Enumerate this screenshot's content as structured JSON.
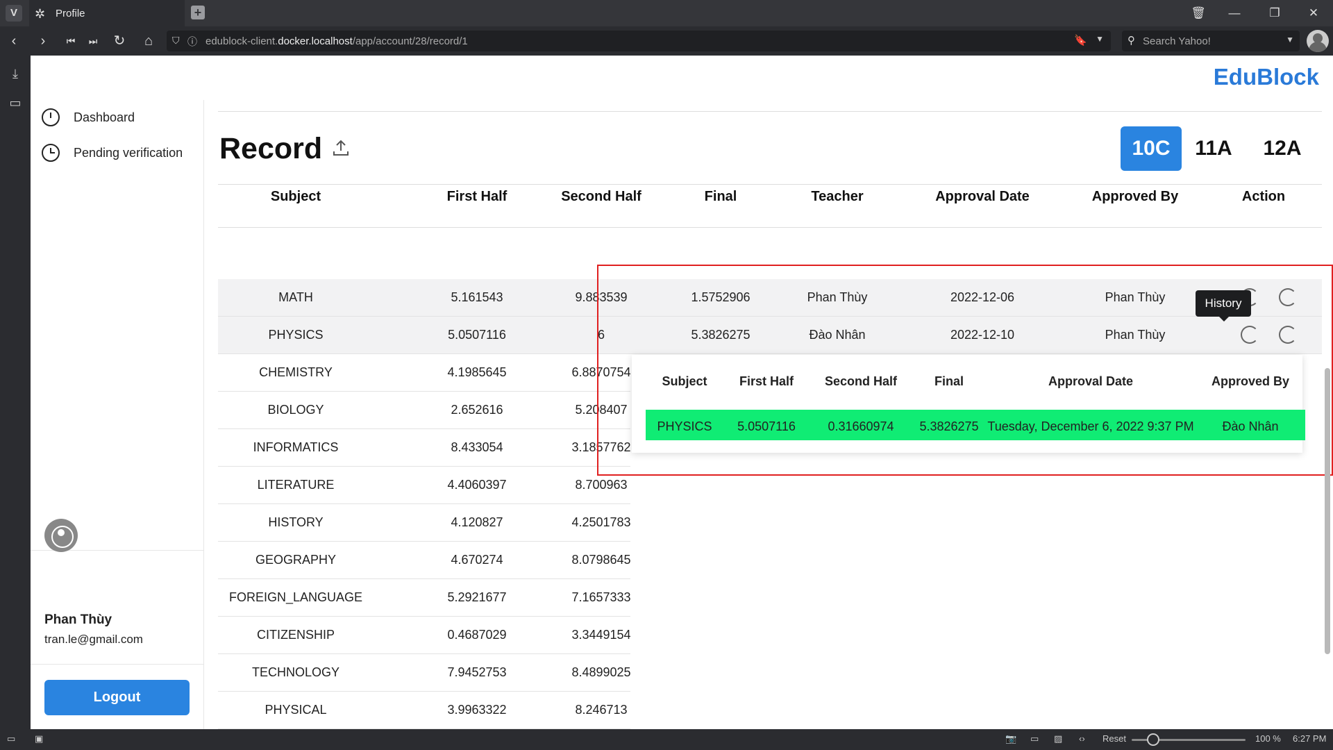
{
  "browser": {
    "tab_title": "Profile",
    "url_prefix": "edublock-client.",
    "url_host": "docker.localhost",
    "url_path": "/app/account/28/record/1",
    "search_placeholder": "Search Yahoo!",
    "status": {
      "reset": "Reset",
      "zoom": "100 %",
      "time": "6:27 PM"
    }
  },
  "app": {
    "brand": "EduBlock",
    "nav": [
      {
        "label": "Dashboard",
        "icon": "dashboard-icon"
      },
      {
        "label": "Pending verification",
        "icon": "clock-icon"
      }
    ],
    "user": {
      "name": "Phan Thùy",
      "email": "tran.le@gmail.com"
    },
    "logout_label": "Logout"
  },
  "page": {
    "title": "Record",
    "grades": [
      {
        "label": "10C",
        "active": true
      },
      {
        "label": "11A",
        "active": false
      },
      {
        "label": "12A",
        "active": false
      }
    ]
  },
  "table": {
    "headers": [
      "Subject",
      "First Half",
      "Second Half",
      "Final",
      "Teacher",
      "Approval Date",
      "Approved By",
      "Action"
    ],
    "rows": [
      {
        "subject": "MATH",
        "first": "5.161543",
        "second": "9.883539",
        "final": "1.5752906",
        "teacher": "Phan Thùy",
        "date": "2022-12-06",
        "approved_by": "Phan Thùy"
      },
      {
        "subject": "PHYSICS",
        "first": "5.0507116",
        "second": "6",
        "final": "5.3826275",
        "teacher": "Đào Nhân",
        "date": "2022-12-10",
        "approved_by": "Phan Thùy"
      },
      {
        "subject": "CHEMISTRY",
        "first": "4.1985645",
        "second": "6.8870754"
      },
      {
        "subject": "BIOLOGY",
        "first": "2.652616",
        "second": "5.208407"
      },
      {
        "subject": "INFORMATICS",
        "first": "8.433054",
        "second": "3.1857762"
      },
      {
        "subject": "LITERATURE",
        "first": "4.4060397",
        "second": "8.700963"
      },
      {
        "subject": "HISTORY",
        "first": "4.120827",
        "second": "4.2501783"
      },
      {
        "subject": "GEOGRAPHY",
        "first": "4.670274",
        "second": "8.0798645"
      },
      {
        "subject": "FOREIGN_LANGUAGE",
        "first": "5.2921677",
        "second": "7.1657333"
      },
      {
        "subject": "CITIZENSHIP",
        "first": "0.4687029",
        "second": "3.3449154"
      },
      {
        "subject": "TECHNOLOGY",
        "first": "7.9452753",
        "second": "8.4899025"
      },
      {
        "subject": "PHYSICAL",
        "first": "3.9963322",
        "second": "8.246713"
      }
    ]
  },
  "tooltip": "History",
  "history": {
    "headers": [
      "Subject",
      "First Half",
      "Second Half",
      "Final",
      "Approval Date",
      "Approved By"
    ],
    "row": [
      "PHYSICS",
      "5.0507116",
      "0.31660974",
      "5.3826275",
      "Tuesday, December 6, 2022 9:37 PM",
      "Đào Nhân"
    ],
    "highlight_color": "#10ec74"
  },
  "colors": {
    "accent": "#2a84e0",
    "brand": "#2a7ad8",
    "annotation": "#e02020"
  }
}
